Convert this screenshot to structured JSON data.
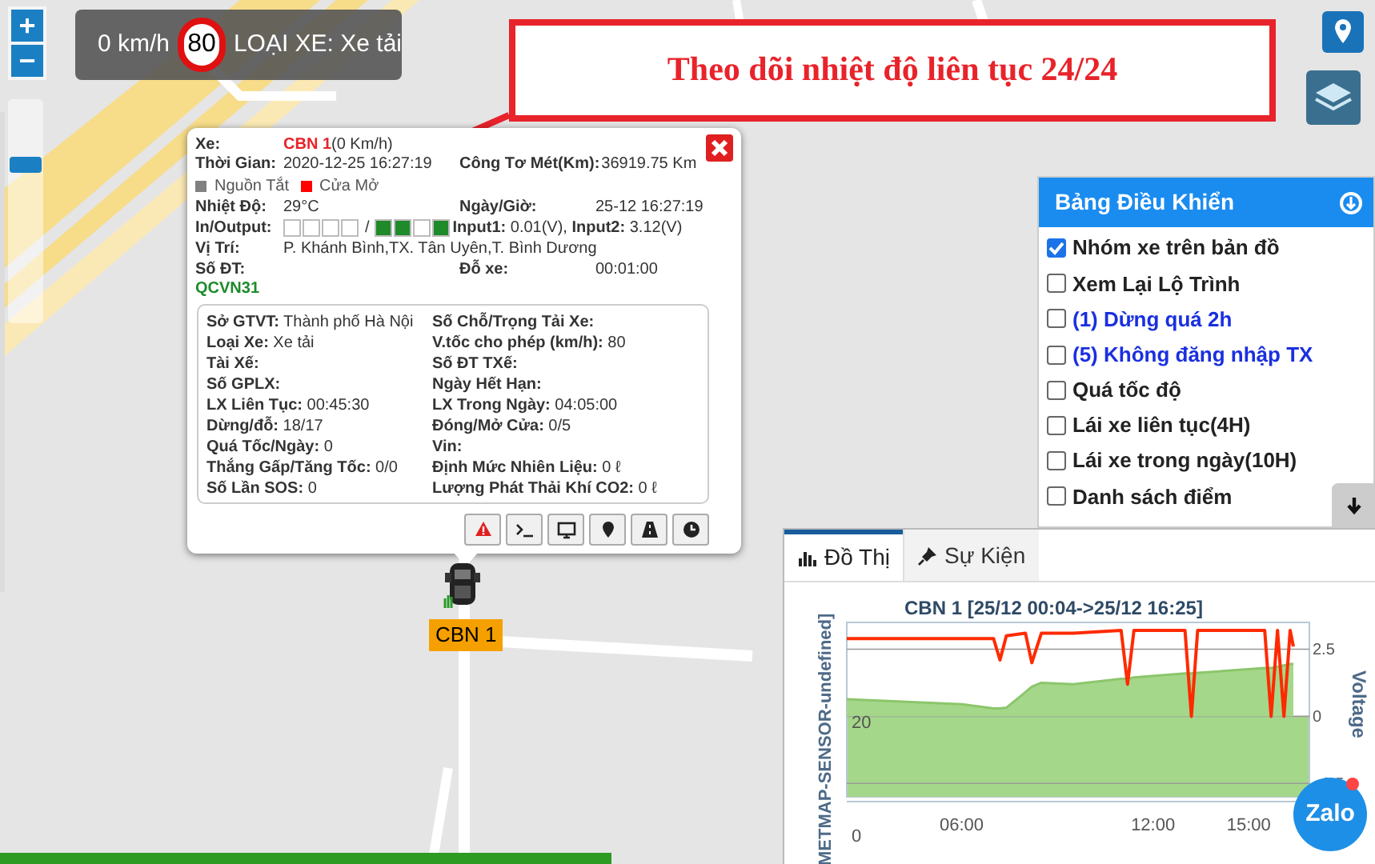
{
  "zoom_controls": {
    "buttons": [
      {
        "label": "+"
      },
      {
        "label": "−"
      }
    ],
    "slider": {
      "level": 0.72
    }
  },
  "speed_overlay": {
    "speed": "0 km/h",
    "limit": "80",
    "vehicle_type": "LOẠI XE: Xe tải"
  },
  "callout": {
    "text": "Theo dõi nhiệt độ liên tục 24/24"
  },
  "popup": {
    "vehicle": {
      "label": "Xe:",
      "name": "CBN 1",
      "speed": "(0 Km/h)"
    },
    "time": {
      "label": "Thời Gian:",
      "value": "2020-12-25 16:27:19",
      "right_label": "Công Tơ Mét(Km):",
      "right_value": "36919.75 Km"
    },
    "legend": [
      {
        "label": "Nguồn Tắt",
        "color": "#808080"
      },
      {
        "label": "Cửa Mở",
        "color": "#ff0000"
      }
    ],
    "temperature": {
      "label": "Nhiệt Độ:",
      "value": "29°C",
      "right_label": "Ngày/Giờ:",
      "right_value": "25-12 16:27:19"
    },
    "io": {
      "label": "In/Output:",
      "inputs": [
        false,
        false,
        false,
        false
      ],
      "separator": "/",
      "outputs": [
        true,
        true,
        false,
        true
      ],
      "readings": "**Input1:** 0.01(V), **Input2:** 3.12(V)"
    },
    "location": {
      "label": "Vị Trí:",
      "value": "P. Khánh Bình,TX. Tân Uyên,T. Bình Dương"
    },
    "phone": {
      "label": "Số ĐT:",
      "right_label": "Đỗ xe:",
      "right_value": "00:01:00"
    },
    "standard": "QCVN31",
    "details": [
      {
        "label": "Sở GTVT:",
        "value": "Thành phố Hà Nội"
      },
      {
        "label": "Số Chỗ/Trọng Tải Xe:"
      },
      {
        "label": "Loại Xe:",
        "value": "Xe tải"
      },
      {
        "label": "V.tốc cho phép (km/h):",
        "value": "80"
      },
      {
        "label": "Tài Xế:"
      },
      {
        "label": "Số ĐT TXế:"
      },
      {
        "label": "Số GPLX:"
      },
      {
        "label": "Ngày Hết Hạn:"
      },
      {
        "label": "LX Liên Tục:",
        "value": "00:45:30"
      },
      {
        "label": "LX Trong Ngày:",
        "value": "04:05:00"
      },
      {
        "label": "Dừng/đỗ:",
        "value": "18/17"
      },
      {
        "label": "Đóng/Mở Cửa:",
        "value": "0/5"
      },
      {
        "label": "Quá Tốc/Ngày:",
        "value": "0"
      },
      {
        "label": "Vin:"
      },
      {
        "label": "Thắng Gấp/Tăng Tốc:",
        "value": "0/0"
      },
      {
        "label": "Định Mức Nhiên Liệu:",
        "value": "0 ℓ"
      },
      {
        "label": "Số Lần SOS:",
        "value": "0"
      },
      {
        "label": "Lượng Phát Thải Khí CO2:",
        "value": "0 ℓ"
      }
    ],
    "actions": [
      {
        "kind": "warning"
      },
      {
        "kind": "terminal"
      },
      {
        "kind": "monitor"
      },
      {
        "kind": "pin"
      },
      {
        "kind": "road"
      },
      {
        "kind": "clock"
      }
    ]
  },
  "marker": {
    "label": "CBN 1"
  },
  "control_panel": {
    "title": "Bảng Điều Khiển",
    "items": [
      {
        "label": "Nhóm xe trên bản đồ",
        "checked": true,
        "kind": "normal"
      },
      {
        "label": "Xem Lại Lộ Trình",
        "checked": false,
        "kind": "normal"
      },
      {
        "label": "(1) Dừng quá 2h",
        "checked": false,
        "kind": "alert"
      },
      {
        "label": "(5) Không đăng nhập TX",
        "checked": false,
        "kind": "alert"
      },
      {
        "label": "Quá tốc độ",
        "checked": false,
        "kind": "normal"
      },
      {
        "label": "Lái xe liên tục(4H)",
        "checked": false,
        "kind": "normal"
      },
      {
        "label": "Lái xe trong ngày(10H)",
        "checked": false,
        "kind": "normal"
      },
      {
        "label": "Danh sách điểm",
        "checked": false,
        "kind": "normal"
      }
    ]
  },
  "chart_panel": {
    "tabs": [
      {
        "label": "Đồ Thị",
        "selected": true,
        "kind": "chart"
      },
      {
        "label": "Sự Kiện",
        "selected": false,
        "kind": "pin"
      }
    ],
    "left_axis": {
      "title": "METMAP-SENSOR-undefined]",
      "ticks": [
        "20",
        "0"
      ]
    },
    "chart_data": {
      "type": "area",
      "title": "CBN 1 [25/12 00:04->25/12 16:25]",
      "x": [
        2.4,
        6,
        7,
        7.2,
        7.4,
        8,
        8.2,
        8.5,
        9.5,
        11,
        11.2,
        11.4,
        13,
        13.2,
        13.4,
        15.5,
        15.7,
        15.9,
        16.1,
        16.3,
        16.4
      ],
      "series": [
        {
          "type": "area",
          "color": "#a5d78a",
          "values": [
            0.64,
            0.45,
            0.3,
            0.3,
            0.32,
            0.9,
            1.1,
            1.25,
            1.2,
            1.4,
            1.4,
            1.45,
            1.6,
            1.6,
            1.62,
            1.8,
            1.8,
            1.85,
            1.9,
            1.95,
            1.95
          ]
        },
        {
          "name": "Voltage",
          "type": "line",
          "color": "#ff2a00",
          "values": [
            2.9,
            2.9,
            2.9,
            2.1,
            3.0,
            3.1,
            2.0,
            3.1,
            3.1,
            3.2,
            1.2,
            3.2,
            3.2,
            0,
            3.2,
            3.2,
            0,
            3.2,
            0,
            3.2,
            2.6
          ]
        }
      ],
      "xlim": [
        2.4,
        16.9
      ],
      "ylim": [
        -3,
        3.5
      ],
      "xticks": [
        {
          "value": 6,
          "label": "06:00"
        },
        {
          "value": 12,
          "label": "12:00"
        },
        {
          "value": 15,
          "label": "15:00"
        }
      ],
      "yticks": [
        2.5,
        0,
        -2.5
      ],
      "grid": true,
      "bands": [
        {
          "axis": "y",
          "from": -3,
          "to": 0,
          "color": "#a5d78a"
        }
      ]
    }
  },
  "zalo_button": {
    "label": "Zalo"
  }
}
